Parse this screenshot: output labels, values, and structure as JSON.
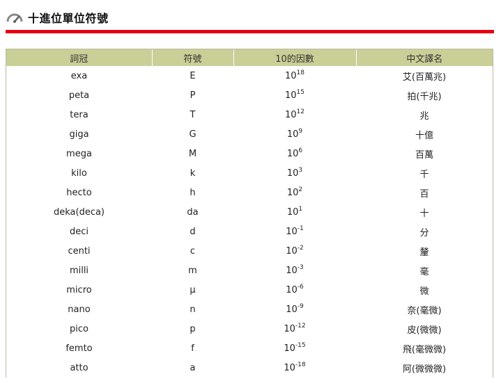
{
  "header": {
    "title": "十進位單位符號",
    "icon": "gauge-icon"
  },
  "colors": {
    "accent_rule": "#e60012",
    "table_header_bg": "#c9cf97"
  },
  "table": {
    "columns": [
      "詞冠",
      "符號",
      "10的因數",
      "中文譯名"
    ],
    "rows": [
      {
        "prefix": "exa",
        "symbol": "E",
        "base": "10",
        "exp": "18",
        "chinese": "艾(百萬兆)"
      },
      {
        "prefix": "peta",
        "symbol": "P",
        "base": "10",
        "exp": "15",
        "chinese": "拍(千兆)"
      },
      {
        "prefix": "tera",
        "symbol": "T",
        "base": "10",
        "exp": "12",
        "chinese": "兆"
      },
      {
        "prefix": "giga",
        "symbol": "G",
        "base": "10",
        "exp": "9",
        "chinese": "十億"
      },
      {
        "prefix": "mega",
        "symbol": "M",
        "base": "10",
        "exp": "6",
        "chinese": "百萬"
      },
      {
        "prefix": "kilo",
        "symbol": "k",
        "base": "10",
        "exp": "3",
        "chinese": "千"
      },
      {
        "prefix": "hecto",
        "symbol": "h",
        "base": "10",
        "exp": "2",
        "chinese": "百"
      },
      {
        "prefix": "deka(deca)",
        "symbol": "da",
        "base": "10",
        "exp": "1",
        "chinese": "十"
      },
      {
        "prefix": "deci",
        "symbol": "d",
        "base": "10",
        "exp": "-1",
        "chinese": "分"
      },
      {
        "prefix": "centi",
        "symbol": "c",
        "base": "10",
        "exp": "-2",
        "chinese": "釐"
      },
      {
        "prefix": "milli",
        "symbol": "m",
        "base": "10",
        "exp": "-3",
        "chinese": "毫"
      },
      {
        "prefix": "micro",
        "symbol": "μ",
        "base": "10",
        "exp": "-6",
        "chinese": "微"
      },
      {
        "prefix": "nano",
        "symbol": "n",
        "base": "10",
        "exp": "-9",
        "chinese": "奈(毫微)"
      },
      {
        "prefix": "pico",
        "symbol": "p",
        "base": "10",
        "exp": "-12",
        "chinese": "皮(微微)"
      },
      {
        "prefix": "femto",
        "symbol": "f",
        "base": "10",
        "exp": "-15",
        "chinese": "飛(毫微微)"
      },
      {
        "prefix": "atto",
        "symbol": "a",
        "base": "10",
        "exp": "-18",
        "chinese": "阿(微微微)"
      }
    ]
  }
}
